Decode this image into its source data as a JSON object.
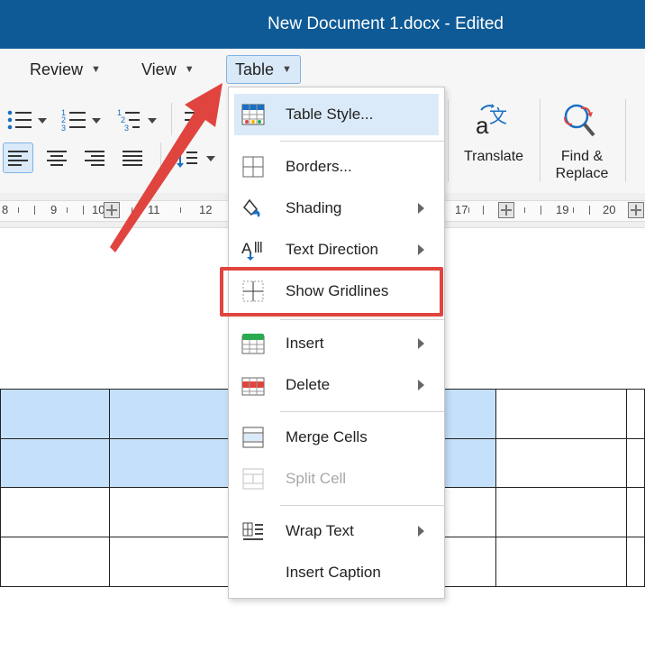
{
  "window": {
    "title": "New Document 1.docx - Edited"
  },
  "menubar": {
    "items": [
      {
        "label": "Review",
        "active": false
      },
      {
        "label": "View",
        "active": false
      },
      {
        "label": "Table",
        "active": true
      }
    ]
  },
  "ribbon": {
    "translate_label": "Translate",
    "find_replace_label_line1": "Find &",
    "find_replace_label_line2": "Replace",
    "icons": [
      "bullet-list-icon",
      "numbered-list-icon",
      "multilevel-list-icon",
      "align-left-icon",
      "align-center-icon",
      "align-right-icon",
      "justify-icon",
      "line-spacing-icon",
      "translate-icon",
      "find-replace-icon"
    ]
  },
  "ruler": {
    "numbers": [
      "8",
      "9",
      "10",
      "11",
      "12",
      "17",
      "19",
      "20"
    ]
  },
  "table_menu": {
    "items": [
      {
        "label": "Table Style...",
        "icon": "table-style-icon",
        "submenu": false,
        "highlighted": true
      },
      {
        "label": "Borders...",
        "icon": "borders-icon",
        "submenu": false
      },
      {
        "label": "Shading",
        "icon": "shading-icon",
        "submenu": true
      },
      {
        "label": "Text Direction",
        "icon": "text-direction-icon",
        "submenu": true
      },
      {
        "label": "Show Gridlines",
        "icon": "gridlines-icon",
        "submenu": false,
        "annotated": true
      },
      {
        "label": "Insert",
        "icon": "insert-table-icon",
        "submenu": true
      },
      {
        "label": "Delete",
        "icon": "delete-table-icon",
        "submenu": true
      },
      {
        "label": "Merge Cells",
        "icon": "merge-cells-icon",
        "submenu": false
      },
      {
        "label": "Split Cell",
        "icon": "split-cell-icon",
        "submenu": false,
        "disabled": true
      },
      {
        "label": "Wrap Text",
        "icon": "wrap-text-icon",
        "submenu": true
      },
      {
        "label": "Insert Caption",
        "icon": "",
        "submenu": false
      }
    ]
  },
  "colors": {
    "titlebar": "#0e5a96",
    "selection": "#c5e0fa",
    "menu_highlight": "#dbeaf8",
    "annotation": "#e0443e"
  }
}
